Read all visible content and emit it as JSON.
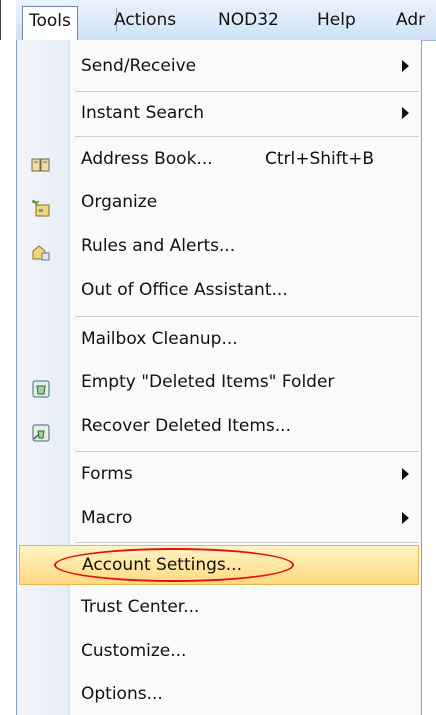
{
  "menubar": {
    "items": [
      {
        "label": "Tools"
      },
      {
        "label": "Actions"
      },
      {
        "label": "NOD32"
      },
      {
        "label": "Help"
      },
      {
        "label": "Adr"
      }
    ]
  },
  "menu": {
    "items": [
      {
        "label": "Send/Receive",
        "submenu": true
      },
      {
        "label": "Instant Search",
        "submenu": true
      },
      {
        "label": "Address Book...",
        "shortcut": "Ctrl+Shift+B",
        "icon": "address-book-icon"
      },
      {
        "label": "Organize",
        "icon": "organize-icon"
      },
      {
        "label": "Rules and Alerts...",
        "icon": "rules-icon"
      },
      {
        "label": "Out of Office Assistant..."
      },
      {
        "label": "Mailbox Cleanup..."
      },
      {
        "label": "Empty \"Deleted Items\" Folder",
        "icon": "empty-deleted-icon"
      },
      {
        "label": "Recover Deleted Items...",
        "icon": "recover-icon"
      },
      {
        "label": "Forms",
        "submenu": true
      },
      {
        "label": "Macro",
        "submenu": true
      },
      {
        "label": "Account Settings...",
        "highlighted": true
      },
      {
        "label": "Trust Center..."
      },
      {
        "label": "Customize..."
      },
      {
        "label": "Options..."
      }
    ]
  },
  "colors": {
    "highlight": "#ffd980",
    "annotation_oval": "#e01010"
  }
}
